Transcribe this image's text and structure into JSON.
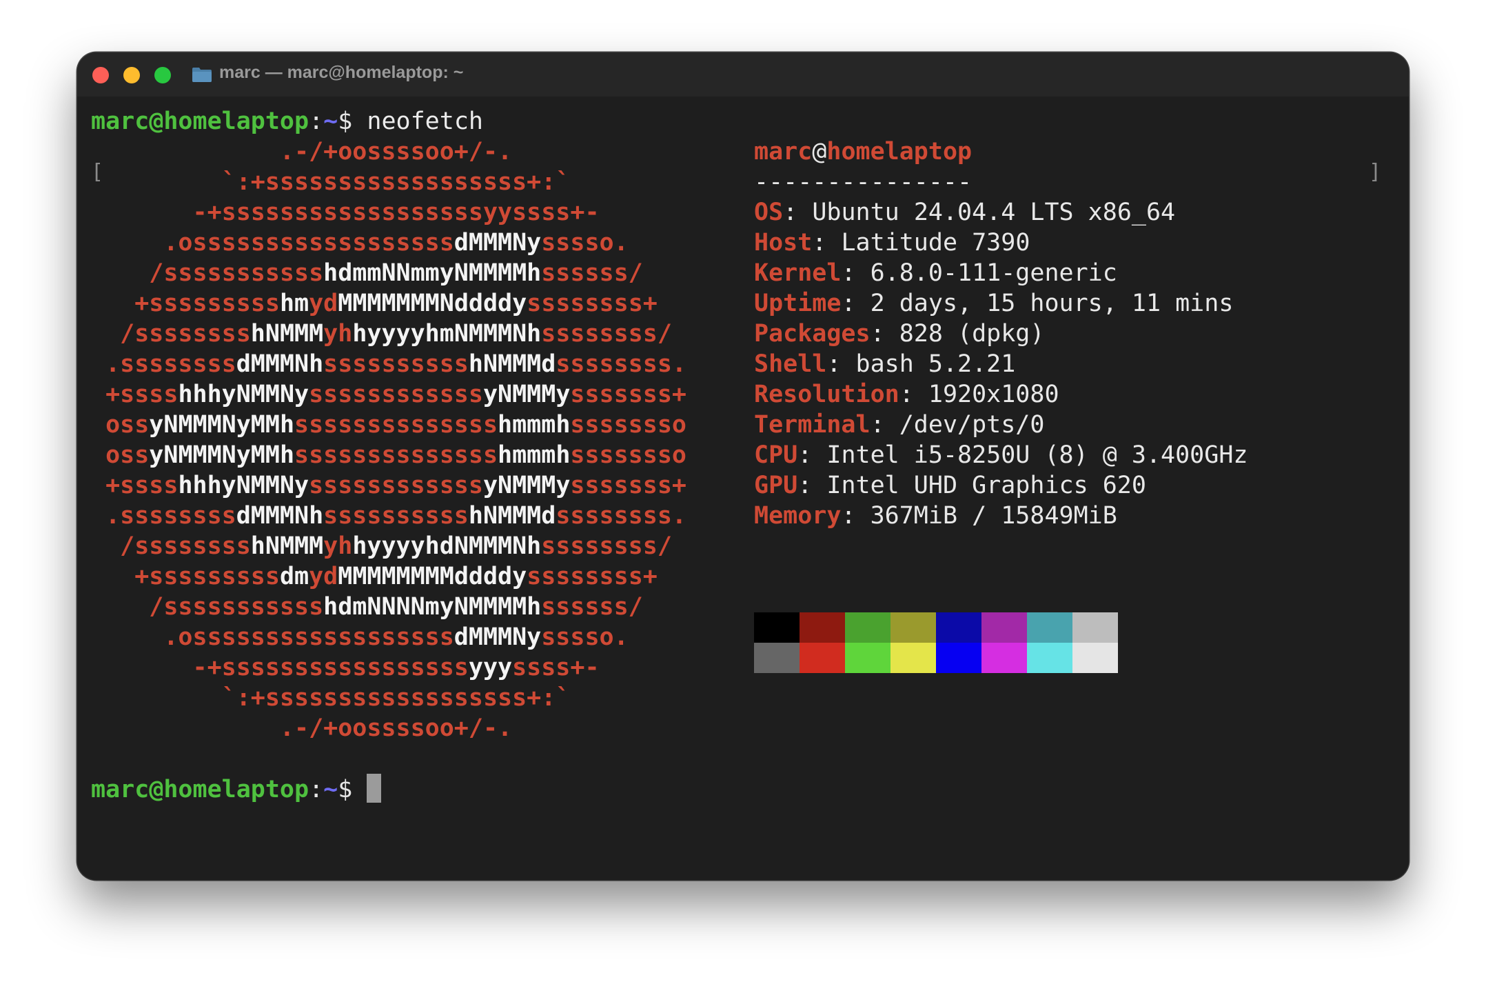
{
  "window": {
    "title": "marc — marc@homelaptop: ~"
  },
  "prompt1": {
    "user": "marc@homelaptop",
    "sep": ":",
    "path": "~",
    "dollar": "$ ",
    "command": "neofetch"
  },
  "logo": {
    "lines": [
      [
        [
          "r",
          "             .-/+oossssoo+/-."
        ]
      ],
      [
        [
          "r",
          "         `:+ssssssssssssssssss+:`"
        ]
      ],
      [
        [
          "r",
          "       -+ssssssssssssssssssyyssss+-"
        ]
      ],
      [
        [
          "r",
          "     .ossssssssssssssssss"
        ],
        [
          "w",
          "dMMMNy"
        ],
        [
          "r",
          "sssso."
        ]
      ],
      [
        [
          "r",
          "    /sssssssssss"
        ],
        [
          "w",
          "hdmmNNmmyNMMMMh"
        ],
        [
          "r",
          "ssssss/"
        ]
      ],
      [
        [
          "r",
          "   +sssssssss"
        ],
        [
          "w",
          "hm"
        ],
        [
          "r",
          "yd"
        ],
        [
          "w",
          "MMMMMMMNddddy"
        ],
        [
          "r",
          "ssssssss+"
        ]
      ],
      [
        [
          "r",
          "  /ssssssss"
        ],
        [
          "w",
          "hNMMM"
        ],
        [
          "r",
          "yh"
        ],
        [
          "w",
          "hyyyyhmNMMMNh"
        ],
        [
          "r",
          "ssssssss/"
        ]
      ],
      [
        [
          "r",
          " .ssssssss"
        ],
        [
          "w",
          "dMMMNh"
        ],
        [
          "r",
          "ssssssssss"
        ],
        [
          "w",
          "hNMMMd"
        ],
        [
          "r",
          "ssssssss."
        ]
      ],
      [
        [
          "r",
          " +ssss"
        ],
        [
          "w",
          "hhhyNMMNy"
        ],
        [
          "r",
          "ssssssssssss"
        ],
        [
          "w",
          "yNMMMy"
        ],
        [
          "r",
          "sssssss+"
        ]
      ],
      [
        [
          "r",
          " oss"
        ],
        [
          "w",
          "yNMMMNyMMh"
        ],
        [
          "r",
          "ssssssssssssss"
        ],
        [
          "w",
          "hmmmh"
        ],
        [
          "r",
          "ssssssso"
        ]
      ],
      [
        [
          "r",
          " oss"
        ],
        [
          "w",
          "yNMMMNyMMh"
        ],
        [
          "r",
          "ssssssssssssss"
        ],
        [
          "w",
          "hmmmh"
        ],
        [
          "r",
          "ssssssso"
        ]
      ],
      [
        [
          "r",
          " +ssss"
        ],
        [
          "w",
          "hhhyNMMNy"
        ],
        [
          "r",
          "ssssssssssss"
        ],
        [
          "w",
          "yNMMMy"
        ],
        [
          "r",
          "sssssss+"
        ]
      ],
      [
        [
          "r",
          " .ssssssss"
        ],
        [
          "w",
          "dMMMNh"
        ],
        [
          "r",
          "ssssssssss"
        ],
        [
          "w",
          "hNMMMd"
        ],
        [
          "r",
          "ssssssss."
        ]
      ],
      [
        [
          "r",
          "  /ssssssss"
        ],
        [
          "w",
          "hNMMM"
        ],
        [
          "r",
          "yh"
        ],
        [
          "w",
          "hyyyyhdNMMMNh"
        ],
        [
          "r",
          "ssssssss/"
        ]
      ],
      [
        [
          "r",
          "   +sssssssss"
        ],
        [
          "w",
          "dm"
        ],
        [
          "r",
          "yd"
        ],
        [
          "w",
          "MMMMMMMMddddy"
        ],
        [
          "r",
          "ssssssss+"
        ]
      ],
      [
        [
          "r",
          "    /sssssssssss"
        ],
        [
          "w",
          "hdmNNNNmyNMMMMh"
        ],
        [
          "r",
          "ssssss/"
        ]
      ],
      [
        [
          "r",
          "     .ossssssssssssssssss"
        ],
        [
          "w",
          "dMMMNy"
        ],
        [
          "r",
          "sssso."
        ]
      ],
      [
        [
          "r",
          "       -+sssssssssssssssss"
        ],
        [
          "w",
          "yyy"
        ],
        [
          "r",
          "ssss+-"
        ]
      ],
      [
        [
          "r",
          "         `:+ssssssssssssssssss+:`"
        ]
      ],
      [
        [
          "r",
          "             .-/+oossssoo+/-."
        ]
      ]
    ]
  },
  "info": {
    "user": "marc",
    "at": "@",
    "host": "homelaptop",
    "separator": "---------------",
    "items": [
      {
        "key": "OS",
        "value": "Ubuntu 24.04.4 LTS x86_64"
      },
      {
        "key": "Host",
        "value": "Latitude 7390"
      },
      {
        "key": "Kernel",
        "value": "6.8.0-111-generic"
      },
      {
        "key": "Uptime",
        "value": "2 days, 15 hours, 11 mins"
      },
      {
        "key": "Packages",
        "value": "828 (dpkg)"
      },
      {
        "key": "Shell",
        "value": "bash 5.2.21"
      },
      {
        "key": "Resolution",
        "value": "1920x1080"
      },
      {
        "key": "Terminal",
        "value": "/dev/pts/0"
      },
      {
        "key": "CPU",
        "value": "Intel i5-8250U (8) @ 3.400GHz"
      },
      {
        "key": "GPU",
        "value": "Intel UHD Graphics 620"
      },
      {
        "key": "Memory",
        "value": "367MiB / 15849MiB"
      }
    ]
  },
  "palette": {
    "normal": [
      "#000000",
      "#8e1a10",
      "#4aa22f",
      "#9a9a2d",
      "#0b0aa8",
      "#a229a7",
      "#49a3ae",
      "#bdbdbd"
    ],
    "bright": [
      "#666666",
      "#d12c1f",
      "#5fd53b",
      "#e4e54a",
      "#0600f2",
      "#d52ee1",
      "#66e3e6",
      "#e5e5e5"
    ]
  },
  "prompt2": {
    "user": "marc@homelaptop",
    "sep": ":",
    "path": "~",
    "dollar": "$ "
  },
  "colors": {
    "prompt_user": "#4fc13f",
    "prompt_path": "#6f6cf3",
    "accent_red": "#d04a35"
  }
}
